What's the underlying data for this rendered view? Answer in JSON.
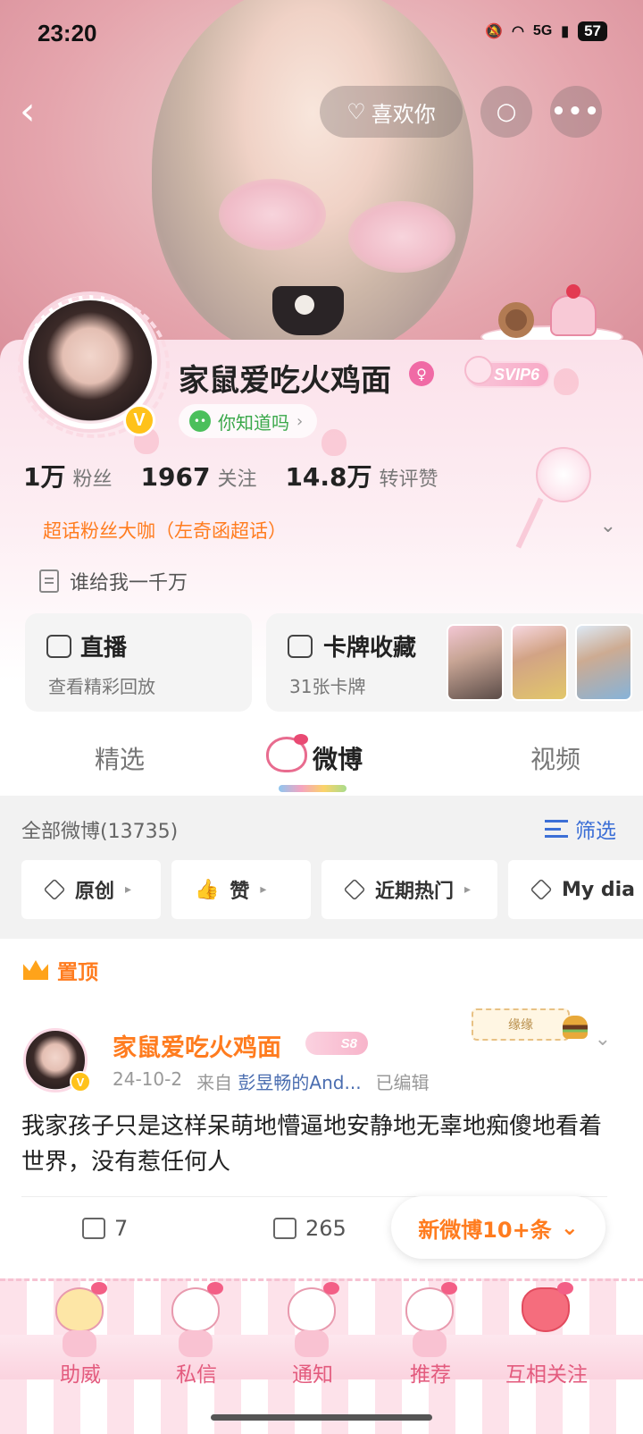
{
  "status_bar": {
    "time": "23:20",
    "network": "5G",
    "battery": "57"
  },
  "header": {
    "like_label": "喜欢你"
  },
  "profile": {
    "name": "家鼠爱吃火鸡面",
    "svip_badge": "SVIP6",
    "tag": "你知道吗",
    "stats": [
      {
        "value": "1万",
        "label": "粉丝"
      },
      {
        "value": "1967",
        "label": "关注"
      },
      {
        "value": "14.8万",
        "label": "转评赞"
      }
    ],
    "superfan": "超话粉丝大咖（左奇函超话）",
    "bio": "谁给我一千万"
  },
  "tiles": {
    "live": {
      "title": "直播",
      "subtitle": "查看精彩回放"
    },
    "cards": {
      "title": "卡牌收藏",
      "subtitle": "31张卡牌"
    }
  },
  "tabs": [
    {
      "label": "精选"
    },
    {
      "label": "微博"
    },
    {
      "label": "视频"
    }
  ],
  "feed": {
    "all_label": "全部微博(13735)",
    "filter_label": "筛选",
    "chips": [
      "原创",
      "赞",
      "近期热门",
      "My dia"
    ]
  },
  "post": {
    "pinned_label": "置顶",
    "author": "家鼠爱吃火鸡面",
    "level_badge": "S8",
    "date": "24-10-2",
    "source_prefix": "来自",
    "source": "彭昱畅的And...",
    "edited": "已编辑",
    "decoration_card": "缘缘",
    "text": "我家孩子只是这样呆萌地懵逼地安静地无辜地痴傻地看着世界，没有惹任何人",
    "shares": "7",
    "comments": "265"
  },
  "new_posts_label": "新微博10+条",
  "bottom_nav": [
    "助威",
    "私信",
    "通知",
    "推荐",
    "互相关注"
  ],
  "colors": {
    "accent_orange": "#ff7c1f",
    "link_blue": "#3c6fd6",
    "pink": "#f06aa5"
  }
}
